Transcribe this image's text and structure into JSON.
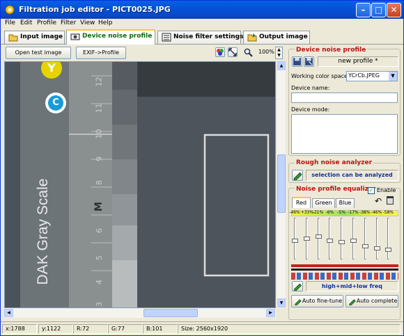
{
  "window": {
    "title": "Filtration job editor - PICT0025.JPG"
  },
  "menu": [
    "File",
    "Edit",
    "Profile",
    "Filter",
    "View",
    "Help"
  ],
  "tabs": [
    {
      "label": "Input image",
      "active": false
    },
    {
      "label": "Device noise profile",
      "active": true
    },
    {
      "label": "Noise filter settings",
      "active": false
    },
    {
      "label": "Output image",
      "active": false
    }
  ],
  "toolbar": {
    "open_test_image": "Open test image",
    "exif_profile": "EXIF->Profile",
    "zoom": "100%"
  },
  "image": {
    "brand_text": "DAK Gray Scale",
    "scale_numbers": [
      "12",
      "11",
      "10",
      "9",
      "8",
      "7",
      "M",
      "6",
      "5",
      "4",
      "3"
    ],
    "badge_c": "C",
    "badge_y": "Y"
  },
  "status": {
    "x": "x:1788",
    "y": "y:1122",
    "r": "R:72",
    "g": "G:77",
    "b": "B:101",
    "size": "Size: 2560x1920"
  },
  "device_profile": {
    "header": "Device noise profile",
    "profile_name": "new profile *",
    "color_space_label": "Working color space:",
    "color_space_value": "YCrCb.JPEG",
    "device_name_label": "Device name:",
    "device_name_value": "",
    "device_mode_label": "Device mode:",
    "device_mode_value": ""
  },
  "analyzer": {
    "header": "Rough noise analyzer",
    "status": "selection can be analyzed"
  },
  "equalizer": {
    "header": "Noise profile equalizer",
    "enable_label": "Enable",
    "enabled": true,
    "channels": [
      "Red",
      "Green",
      "Blue"
    ],
    "active_channel": "Red",
    "percentages": [
      "-46%",
      "+33%",
      "-21%",
      "-6%",
      "-5%",
      "-17%",
      "-38%",
      "-46%",
      "-58%"
    ],
    "levels": [
      0.55,
      0.5,
      0.45,
      0.55,
      0.6,
      0.55,
      0.7,
      0.75,
      0.8
    ],
    "freq_label": "high+mid+low freq",
    "auto_finetune": "Auto fine-tune",
    "auto_complete": "Auto complete"
  },
  "colors": {
    "title_bar": "#0A5FE4",
    "accent_red": "#C01010",
    "selection_box": "#DCDCDC"
  }
}
